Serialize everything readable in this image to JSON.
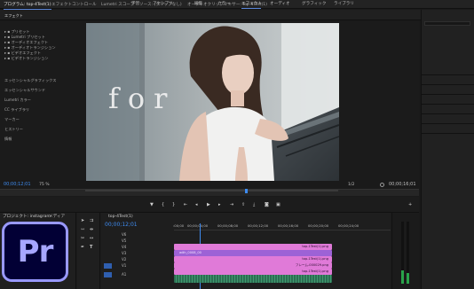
{
  "workspace_menu": [
    "学習",
    "アセンブリ",
    "編集",
    "カラー",
    "エフェクト",
    "オーディオ",
    "グラフィック",
    "ライブラリ"
  ],
  "workspace_active": "エフェクト",
  "panel_tabs": [
    "プログラム: top-4Test(1)",
    "エフェクトコントロール",
    "Lumetri スコープ",
    "ソース: (クリップなし)",
    "オーディオクリップミキサー: top-4Test(1)"
  ],
  "right_panel": {
    "title": "エフェクト",
    "folders": [
      "プリセット",
      "Lumetri プリセット",
      "オーディオエフェクト",
      "オーディオトランジション",
      "ビデオエフェクト",
      "ビデオトランジション"
    ],
    "sections": [
      "エッセンシャルグラフィックス",
      "エッセンシャルサウンド",
      "Lumetri カラー",
      "CC ライブラリ",
      "マーカー",
      "ヒストリー",
      "情報"
    ]
  },
  "overlay_text": "for",
  "monitor": {
    "timecode_left": "00;00;12;01",
    "zoom": "75 %",
    "resolution": "1/2",
    "timecode_right": "00;00;16;01"
  },
  "project_panel": {
    "tabs": [
      "プロジェクト: instagram",
      "メディア"
    ]
  },
  "timeline": {
    "tab": "top-4Test(1)",
    "timecode": "00;00;12;01",
    "ruler": [
      ":00;00",
      "00;00;04;00",
      "00;00;08;00",
      "00;00;12;00",
      "00;00;16;00",
      "00;00;20;00",
      "00;00;24;00"
    ],
    "tracks": [
      "V6",
      "V5",
      "V4",
      "V3",
      "V2",
      "V1",
      "A1"
    ],
    "clips": [
      {
        "label": "top-1Test(1).png",
        "color": "#e07ad8"
      },
      {
        "label": "with_0008_00",
        "color": "#9d62d6"
      },
      {
        "label": "top-1Test(1).png",
        "color": "#e07ad8"
      },
      {
        "label": "フレーム-000029.png",
        "color": "#e07ad8"
      },
      {
        "label": "top-1Test(1).png",
        "color": "#e07ad8"
      },
      {
        "label": "",
        "color": "#2c6e52"
      }
    ]
  },
  "logo_text": "Pr",
  "colors": {
    "accent": "#3e8bf0",
    "logo_bg": "#020035",
    "logo_border": "#9999ff"
  }
}
